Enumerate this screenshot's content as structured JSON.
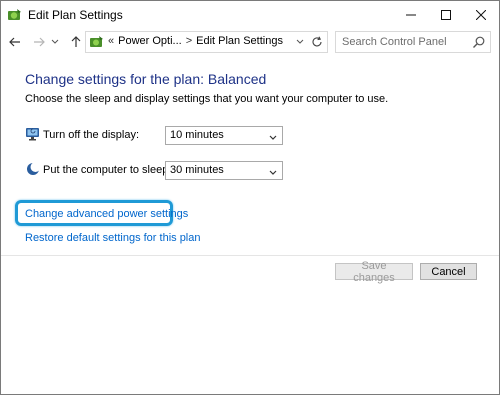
{
  "window": {
    "title": "Edit Plan Settings"
  },
  "address": {
    "crumb_prefix": "«",
    "crumbs": [
      "Power Opti...",
      "Edit Plan Settings"
    ],
    "separator": ">"
  },
  "search": {
    "placeholder": "Search Control Panel"
  },
  "main": {
    "heading": "Change settings for the plan: Balanced",
    "subtext": "Choose the sleep and display settings that you want your computer to use.",
    "settings": [
      {
        "label": "Turn off the display:",
        "value": "10 minutes",
        "icon": "monitor-icon"
      },
      {
        "label": "Put the computer to sleep:",
        "value": "30 minutes",
        "icon": "moon-icon"
      }
    ],
    "links": {
      "advanced": "Change advanced power settings",
      "restore": "Restore default settings for this plan"
    }
  },
  "buttons": {
    "save": "Save changes",
    "cancel": "Cancel"
  },
  "colors": {
    "heading": "#1e3287",
    "link": "#0066cc",
    "highlight": "#1f9ad6"
  }
}
